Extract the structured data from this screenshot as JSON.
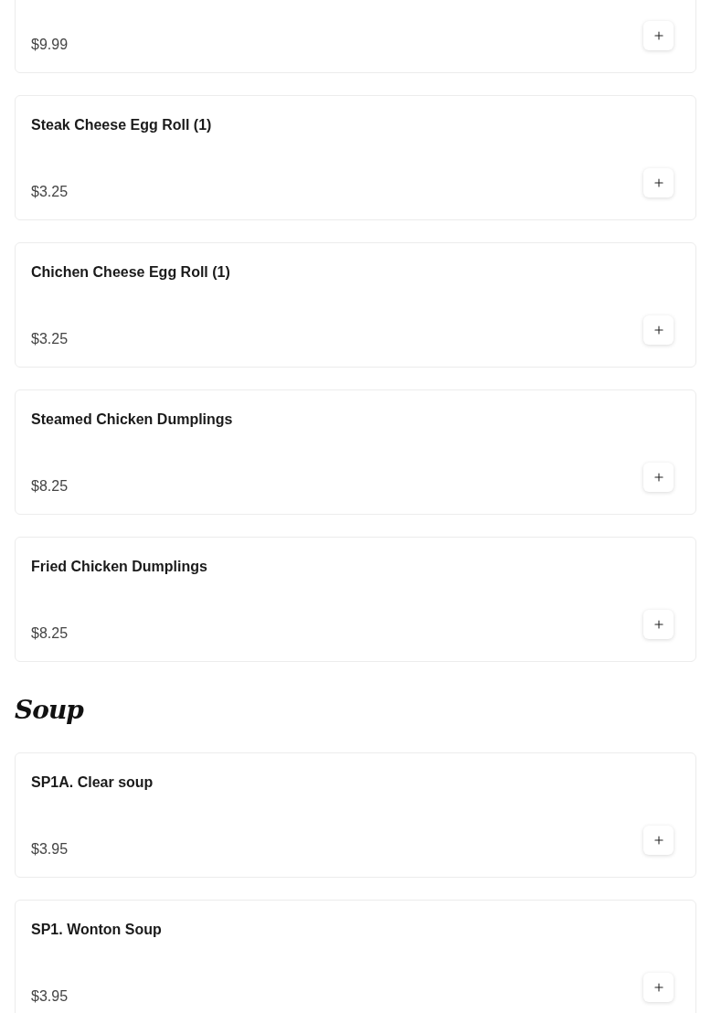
{
  "sections": [
    {
      "items": [
        {
          "price": "$9.99"
        },
        {
          "name": "Steak Cheese Egg Roll (1)",
          "price": "$3.25"
        },
        {
          "name": "Chichen Cheese Egg Roll (1)",
          "price": "$3.25"
        },
        {
          "name": "Steamed Chicken Dumplings",
          "price": "$8.25"
        },
        {
          "name": "Fried Chicken Dumplings",
          "price": "$8.25"
        }
      ]
    },
    {
      "heading": "Soup",
      "items": [
        {
          "name": "SP1A. Clear soup",
          "price": "$3.95"
        },
        {
          "name": "SP1. Wonton Soup",
          "price": "$3.95"
        }
      ]
    }
  ]
}
